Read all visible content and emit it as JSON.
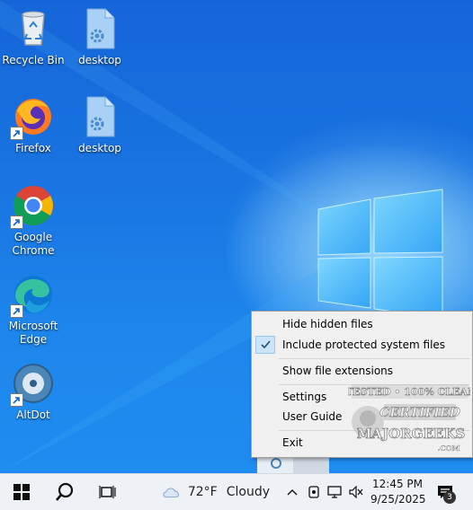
{
  "desktop": {
    "icons": [
      {
        "label": "Recycle Bin"
      },
      {
        "label": "desktop"
      },
      {
        "label": "Firefox"
      },
      {
        "label": "desktop"
      },
      {
        "label": "Google Chrome"
      },
      {
        "label": "Microsoft Edge"
      },
      {
        "label": "AltDot"
      }
    ]
  },
  "context_menu": {
    "items": [
      {
        "label": "Hide hidden files",
        "checked": false
      },
      {
        "label": "Include protected system files",
        "checked": true
      },
      {
        "label": "Show file extensions",
        "checked": false
      },
      {
        "label": "Settings",
        "checked": false
      },
      {
        "label": "User Guide",
        "checked": false
      },
      {
        "label": "Exit",
        "checked": false
      }
    ]
  },
  "watermark": {
    "line1": "TESTED • 100% CLEAN",
    "line2": "CERTIFIED",
    "line3": "MAJORGEEKS",
    "line4": ".COM"
  },
  "taskbar": {
    "weather": {
      "temp": "72°F",
      "condition": "Cloudy"
    },
    "clock": {
      "time": "12:45 PM",
      "date": "9/25/2025"
    },
    "notification_count": "3",
    "icons": [
      "start-icon",
      "search-icon",
      "task-view-icon",
      "weather-cloud-icon",
      "chevron-up-icon",
      "altdot-tray-icon",
      "network-icon",
      "volume-muted-icon",
      "notification-icon"
    ]
  },
  "colors": {
    "wallpaper": "#1a75e2",
    "menu_bg": "#f0f0f0",
    "check_highlight": "#cce4f7",
    "taskbar": "#eef1f6"
  }
}
